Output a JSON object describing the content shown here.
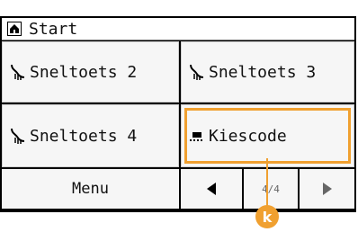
{
  "header": {
    "title": "Start",
    "icon": "home-icon"
  },
  "tiles": [
    {
      "label": "Sneltoets 2",
      "icon": "speed-dial-icon"
    },
    {
      "label": "Sneltoets 3",
      "icon": "speed-dial-icon"
    },
    {
      "label": "Sneltoets 4",
      "icon": "speed-dial-icon"
    },
    {
      "label": "Kiescode",
      "icon": "dial-code-icon",
      "selected": true
    }
  ],
  "bottom_bar": {
    "menu_label": "Menu",
    "page_indicator": "4/4",
    "prev_icon": "triangle-left-icon",
    "next_icon": "triangle-right-icon"
  },
  "callout": {
    "label": "k",
    "color": "#f0a030"
  }
}
